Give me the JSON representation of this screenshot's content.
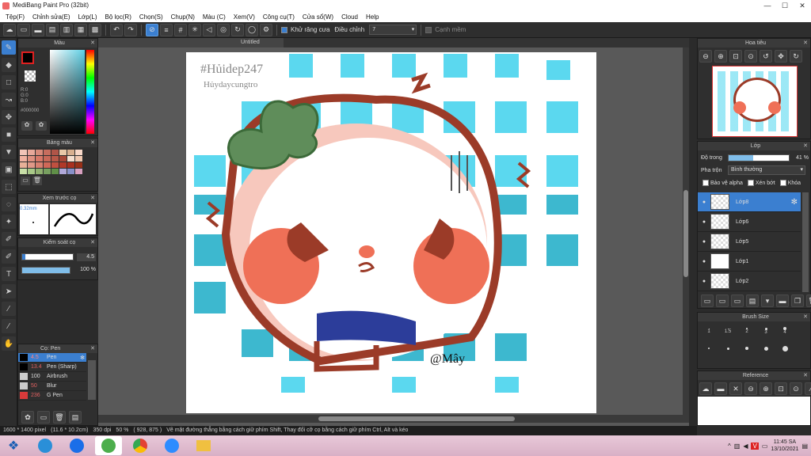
{
  "window": {
    "title": "MediBang Paint Pro (32bit)"
  },
  "window_buttons": [
    "—",
    "☐",
    "✕"
  ],
  "menu": [
    "Tệp(F)",
    "Chỉnh sửa(E)",
    "Lớp(L)",
    "Bộ lọc(R)",
    "Chọn(S)",
    "Chụp(N)",
    "Màu (C)",
    "Xem(V)",
    "Công cụ(T)",
    "Cửa sổ(W)",
    "Cloud",
    "Help"
  ],
  "toolbar": {
    "antialias_label": "Khử răng cưa",
    "adjust_label": "Điều chỉnh",
    "adjust_value": "7",
    "smooth_label": "Cạnh mềm"
  },
  "color_panel": {
    "title": "Màu",
    "r": "R:0",
    "g": "G:0",
    "b": "B:0",
    "hex": "#000000"
  },
  "palette_panel": {
    "title": "Bảng màu",
    "colors": [
      "#f2c4b8",
      "#e8a89a",
      "#d88a7a",
      "#c66d5e",
      "#b05548",
      "#e8c8a8",
      "#d8b090",
      "#f8d8c8",
      "#f0b0a0",
      "#e09080",
      "#d87868",
      "#c86858",
      "#b85848",
      "#a84838",
      "#f6e0d0",
      "#f0c8b0",
      "#e8b098",
      "#e09888",
      "#d88070",
      "#d06858",
      "#c05040",
      "#b03828",
      "#a83020",
      "#983018",
      "#c9e0a8",
      "#a8c888",
      "#90b070",
      "#78a060",
      "#609048",
      "#b0a8d8",
      "#8890c8",
      "#d8a0c0"
    ]
  },
  "preview_panel": {
    "title": "Xem trước cọ",
    "size": "0.32mm"
  },
  "brush_control": {
    "title": "Kiểm soát cọ",
    "size": "4.5",
    "opacity": "100 %"
  },
  "brush_panel": {
    "title": "Cọ: Pen",
    "items": [
      {
        "size": "4.5",
        "name": "Pen",
        "color": "#000000"
      },
      {
        "size": "13.4",
        "name": "Pen (Sharp)",
        "color": "#000000"
      },
      {
        "size": "100",
        "name": "Airbrush",
        "color": "#cccccc"
      },
      {
        "size": "50",
        "name": "Blur",
        "color": "#cccccc"
      },
      {
        "size": "236",
        "name": "G Pen",
        "color": "#d83a3a"
      }
    ]
  },
  "document": {
    "tab": "Untitled",
    "watermark_1": "#Hủidep247",
    "watermark_2": "Hủydaycungtro",
    "signature": "@Mây"
  },
  "navigator": {
    "title": "Hoa tiêu"
  },
  "layer_panel": {
    "title": "Lớp",
    "opacity_label": "Độ trong",
    "opacity_value": "41 %",
    "blend_label": "Pha trộn",
    "blend_value": "Bình thường",
    "protect_alpha": "Bảo vệ alpha",
    "clipping": "Xén bớt",
    "lock": "Khóa",
    "layers": [
      {
        "name": "Lớp8"
      },
      {
        "name": "Lớp6"
      },
      {
        "name": "Lớp5"
      },
      {
        "name": "Lớp1"
      },
      {
        "name": "Lớp2"
      }
    ]
  },
  "brush_size_panel": {
    "title": "Brush Size",
    "sizes": [
      "1",
      "1.5",
      "2",
      "3",
      "4",
      "5"
    ],
    "sizes2": [
      "7",
      "10",
      "15",
      "20",
      "30",
      "40"
    ]
  },
  "reference_panel": {
    "title": "Reference"
  },
  "status": {
    "size": "1600 * 1400 pixel",
    "cm": "(11.6 * 10.2cm)",
    "dpi": "350 dpi",
    "zoom": "50 %",
    "coords": "( 928, 875 )",
    "hint": "Vẽ mặt đường thẳng bằng cách giữ phím Shift, Thay đổi cỡ cọ bằng cách giữ phím Ctrl, Alt và kéo"
  },
  "clock": {
    "time": "11:45 SA",
    "date": "13/10/2021"
  },
  "taskbar_apps": [
    "start",
    "edge",
    "zalo",
    "coc-coc",
    "chrome",
    "zoom",
    "files"
  ]
}
